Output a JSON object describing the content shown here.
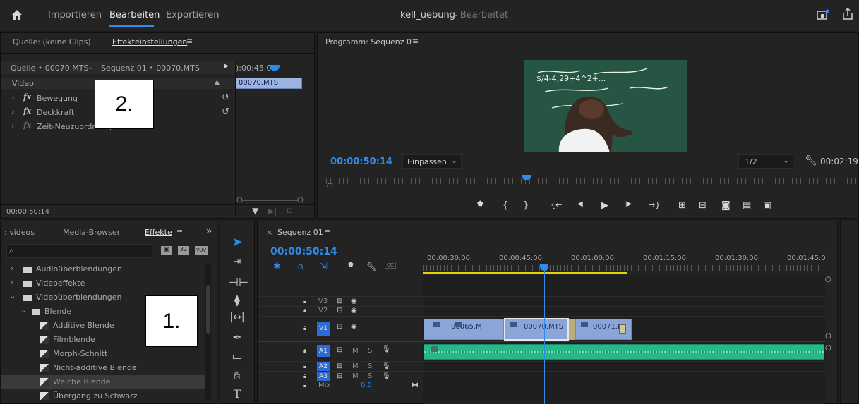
{
  "menu": {
    "home_icon": "home-icon",
    "import": "Importieren",
    "edit": "Bearbeiten",
    "export": "Exportieren",
    "title": "kell_uebung",
    "status": "- Bearbeitet"
  },
  "source_panel": {
    "tab_source": "Quelle: (keine Clips)",
    "tab_effects": "Effekteinstellungen",
    "menu_icon": "≡",
    "source_clip": "Quelle • 00070.MTS",
    "sequence_clip": "Sequenz 01 • 00070.MTS",
    "timecode_head": "):00:45:00",
    "clip_name": "00070.MTS",
    "video_label": "Video",
    "effects": [
      "Bewegung",
      "Deckkraft",
      "Zeit-Neuzuordnung"
    ],
    "fx_symbol": "fx",
    "reset_icon": "↺",
    "timecode": "00:00:50:14"
  },
  "program_panel": {
    "title": "Programm: Sequenz 01",
    "menu_icon": "≡",
    "timecode": "00:00:50:14",
    "fit": "Einpassen",
    "resolution": "1/2",
    "duration": "00:02:19",
    "board_text": "$/4-4,29+4^2+...",
    "controls": [
      "marker-icon",
      "in-icon",
      "out-icon",
      "go-to-in-icon",
      "step-back-icon",
      "play-icon",
      "step-forward-icon",
      "go-to-out-icon",
      "lift-icon",
      "extract-icon",
      "export-frame-icon",
      "insert-icon",
      "overwrite-icon"
    ]
  },
  "project_panel": {
    "tab_videos": ": videos",
    "tab_media": "Media-Browser",
    "tab_effects": "Effekte",
    "overflow": "»",
    "items": [
      {
        "label": "Audioüberblendungen",
        "level": 0,
        "type": "folder"
      },
      {
        "label": "Videoeffekte",
        "level": 0,
        "type": "folder"
      },
      {
        "label": "Videoüberblendungen",
        "level": 0,
        "type": "folder"
      },
      {
        "label": "Blende",
        "level": 1,
        "type": "folder"
      },
      {
        "label": "Additive Blende",
        "level": 2,
        "type": "blend"
      },
      {
        "label": "Filmblende",
        "level": 2,
        "type": "blend"
      },
      {
        "label": "Morph-Schnitt",
        "level": 2,
        "type": "blend"
      },
      {
        "label": "Nicht-additive Blende",
        "level": 2,
        "type": "blend"
      },
      {
        "label": "Weiche Blende",
        "level": 2,
        "type": "blend",
        "selected": true
      },
      {
        "label": "Übergang zu Schwarz",
        "level": 2,
        "type": "blend"
      }
    ],
    "badge_32": "32",
    "badge_yuv": "YUV"
  },
  "callouts": {
    "one": "1.",
    "two": "2."
  },
  "timeline": {
    "tab": "Sequenz 01",
    "close": "×",
    "menu_icon": "≡",
    "timecode": "00:00:50:14",
    "ruler": [
      "00:00:30:00",
      "00:00:45:00",
      "00:01:00:00",
      "00:01:15:00",
      "00:01:30:00",
      "00:01:45:0"
    ],
    "video_tracks": [
      "V3",
      "V2",
      "V1"
    ],
    "audio_tracks": [
      "A1",
      "A2",
      "A3"
    ],
    "mix_label": "Mix",
    "mix_value": "0,0",
    "mute": "M",
    "solo": "S",
    "clips": [
      "00065.M",
      "00070.MTS",
      "00071.M"
    ]
  },
  "tools": [
    "selection-tool-icon",
    "track-select-icon",
    "ripple-edit-icon",
    "razor-icon",
    "slip-icon",
    "pen-icon",
    "rectangle-icon",
    "hand-icon",
    "type-icon"
  ],
  "colors": {
    "accent": "#2d8ceb",
    "clip": "#8aa6d8",
    "audio": "#26b888",
    "timeline_yellow": "#e6d600"
  }
}
